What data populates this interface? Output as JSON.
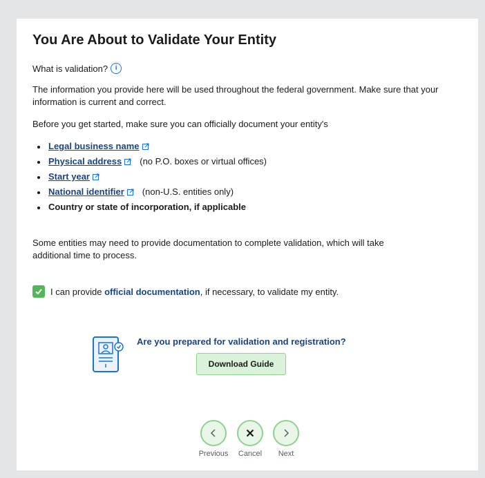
{
  "dialog": {
    "title": "You Are About to Validate Your Entity",
    "what_is_validation": "What is validation?",
    "intro": "The information you provide here will be used throughout the federal government. Make sure that your information is current and correct.",
    "before_start": "Before you get started, make sure you can officially document your entity's",
    "requirements": [
      {
        "label": "Legal business name",
        "note": ""
      },
      {
        "label": "Physical address",
        "note": "(no P.O. boxes or virtual offices)"
      },
      {
        "label": "Start year",
        "note": ""
      },
      {
        "label": "National identifier",
        "note": "(non-U.S. entities only)"
      },
      {
        "label": "Country or state of incorporation, if applicable",
        "note": ""
      }
    ],
    "documentation_note": "Some entities may need to provide documentation to complete validation, which will take additional time to process.",
    "checkbox": {
      "checked": true,
      "prefix": "I can provide",
      "link": "official documentation",
      "suffix": ", if necessary, to validate my entity."
    },
    "guide": {
      "question": "Are you prepared for validation and registration?",
      "button": "Download Guide"
    },
    "nav": {
      "previous": "Previous",
      "cancel": "Cancel",
      "next": "Next"
    }
  },
  "colors": {
    "link": "#1a4480",
    "accent_green": "#54b65a",
    "button_bg": "#d9f2d9",
    "info_blue": "#1a72d6"
  }
}
